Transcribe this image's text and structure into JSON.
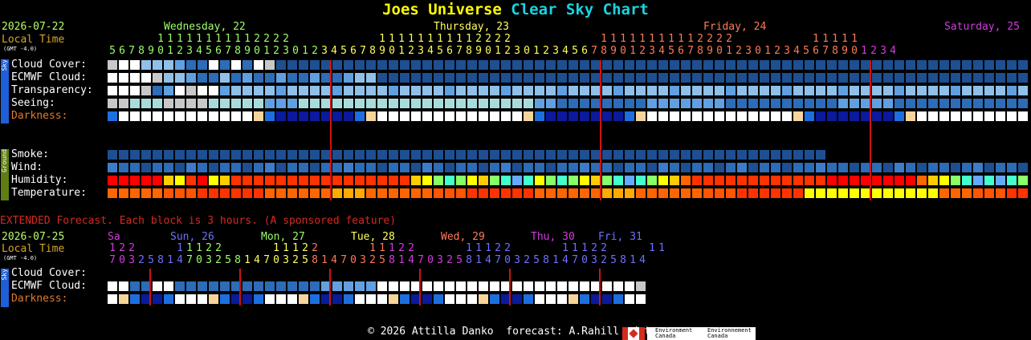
{
  "title": {
    "part1": "Joes Universe",
    "part2": "Clear Sky Chart"
  },
  "top": {
    "date": "2026-07-22",
    "local_time": "Local Time",
    "gmt": "(GMT -4.0)",
    "days": [
      {
        "label": "Wednesday, 22",
        "color": "#9bff6a"
      },
      {
        "label": "Thursday, 23",
        "color": "#ffff5a"
      },
      {
        "label": "Friday, 24",
        "color": "#ff7a56"
      },
      {
        "label": "Saturday, 25",
        "color": "#d43be0"
      }
    ],
    "hours_tens": "     11111111112222         11111111112222         11111111112222        11111",
    "hours_ones": "5678901234567890123012345678901234567890123012345678901234567890123012345678901234",
    "rows": [
      "Cloud Cover:",
      "ECMWF Cloud:",
      "Transparency:",
      "Seeing:",
      "Darkness:"
    ],
    "ground_rows": [
      "Smoke:",
      "Wind:",
      "Humidity:",
      "Temperature:"
    ],
    "side_sky": "Sky",
    "side_ground": "Ground"
  },
  "extended": {
    "title": "EXTENDED Forecast. Each block is 3 hours. (A sponsored feature)",
    "date": "2026-07-25",
    "local_time": "Local Time",
    "gmt": "(GMT -4.0)",
    "days": [
      {
        "label": "Sa",
        "color": "#d43be0"
      },
      {
        "label": "Sun, 26",
        "color": "#6f71ff"
      },
      {
        "label": "Mon, 27",
        "color": "#9bff6a"
      },
      {
        "label": "Tue, 28",
        "color": "#ffff5a"
      },
      {
        "label": "Wed, 29",
        "color": "#ff7a56"
      },
      {
        "label": "Thu, 30",
        "color": "#d43be0"
      },
      {
        "label": "Fri, 31",
        "color": "#6f71ff"
      }
    ],
    "hours_tens": "122    11122     11122     11122     11122     11122    11",
    "hours_ones": "70325814703258147032581470325814703258147032581470325814",
    "rows": [
      "Cloud Cover:",
      "ECMWF Cloud:",
      "Darkness:"
    ],
    "side_sky": "Sky"
  },
  "footer": {
    "text": "© 2026 Attilla Danko  forecast: A.Rahill  data:",
    "env1": "Environment Canada",
    "env2": "Environnement Canada"
  },
  "colors": {
    "clear": "#ffffff",
    "light": "#c8c8c8",
    "blue1": "#90c0e8",
    "blue2": "#60a0e0",
    "blue3": "#2d6cb6",
    "blue4": "#1d4f91",
    "blue5": "#0d3a7a",
    "hour_line": "#d11111"
  }
}
